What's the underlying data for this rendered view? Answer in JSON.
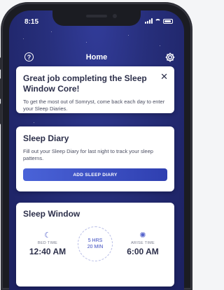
{
  "status_bar": {
    "time": "8:15"
  },
  "header": {
    "title": "Home"
  },
  "welcome_card": {
    "title": "Great job completing the Sleep Window Core!",
    "body": "To get the most out of Somryst, come back each day to enter your Sleep Diaries."
  },
  "diary_card": {
    "title": "Sleep Diary",
    "body": "Fill out your Sleep Diary for last night to track your sleep patterns.",
    "button_label": "ADD SLEEP DIARY"
  },
  "sleep_window": {
    "title": "Sleep Window",
    "bed_label": "BED TIME",
    "bed_value": "12:40 AM",
    "duration_hours": "5 HRS",
    "duration_minutes": "20 MIN",
    "arise_label": "ARISE TIME",
    "arise_value": "6:00 AM"
  },
  "colors": {
    "background_top": "#323c9a",
    "background_bottom": "#1c2160",
    "accent": "#4a63d8",
    "card": "#ffffff",
    "heading_text": "#2c2f4a"
  },
  "icons": [
    "help-icon",
    "gear-icon",
    "close-icon",
    "moon-icon",
    "sun-icon"
  ]
}
